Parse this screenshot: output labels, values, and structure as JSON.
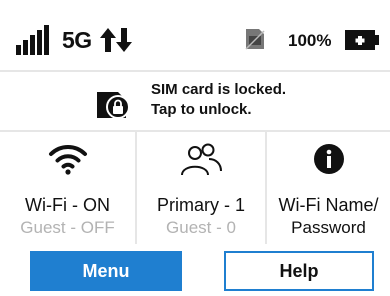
{
  "status_bar": {
    "network_type": "5G",
    "signal_icon": "signal-bars-icon",
    "data_activity_icon": "up-down-arrows-icon",
    "sim_status_icon": "sim-card-icon",
    "battery_percent": "100%",
    "battery_icon": "battery-charging-icon",
    "battery_level_fraction": 1.0
  },
  "sim_banner": {
    "icon": "sim-lock-icon",
    "line1": "SIM card is locked.",
    "line2": "Tap to unlock."
  },
  "tiles": [
    {
      "icon": "wifi-icon",
      "main": "Wi-Fi - ON",
      "sub": "Guest - OFF"
    },
    {
      "icon": "users-icon",
      "main": "Primary - 1",
      "sub": "Guest - 0"
    },
    {
      "icon": "info-icon",
      "main": "Wi-Fi Name/",
      "sub": "Password"
    }
  ],
  "buttons": {
    "menu_label": "Menu",
    "help_label": "Help"
  },
  "colors": {
    "accent": "#1f7fd0",
    "muted_text": "#b3b3b3",
    "divider": "#e6e6e6"
  }
}
